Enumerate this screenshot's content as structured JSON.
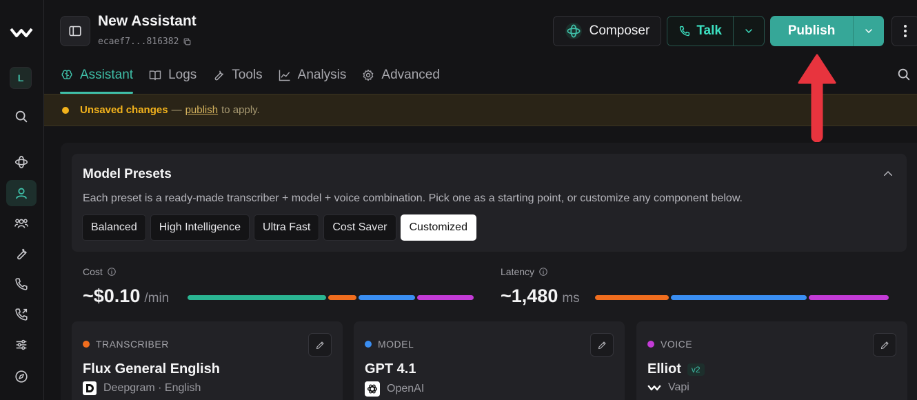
{
  "rail": {
    "workspace_initial": "L"
  },
  "header": {
    "title": "New Assistant",
    "assistant_id": "ecaef7...816382"
  },
  "actions": {
    "composer_label": "Composer",
    "talk_label": "Talk",
    "publish_label": "Publish"
  },
  "tabs": [
    {
      "label": "Assistant",
      "icon": "brain-icon",
      "active": true
    },
    {
      "label": "Logs",
      "icon": "book-icon",
      "active": false
    },
    {
      "label": "Tools",
      "icon": "wrench-icon",
      "active": false
    },
    {
      "label": "Analysis",
      "icon": "chart-line-icon",
      "active": false
    },
    {
      "label": "Advanced",
      "icon": "gear-icon",
      "active": false
    }
  ],
  "banner": {
    "status": "Unsaved changes",
    "dash": "—",
    "link": "publish",
    "suffix": "to apply."
  },
  "presets": {
    "title": "Model Presets",
    "description": "Each preset is a ready-made transcriber + model + voice combination. Pick one as a starting point, or customize any component below.",
    "options": [
      "Balanced",
      "High Intelligence",
      "Ultra Fast",
      "Cost Saver",
      "Customized"
    ],
    "selected": "Customized"
  },
  "cost": {
    "label": "Cost",
    "value": "~$0.10",
    "unit": "/min",
    "segments": [
      {
        "color": "#2ab592",
        "share": 0.49
      },
      {
        "color": "#f06d1e",
        "share": 0.1
      },
      {
        "color": "#3a8ef2",
        "share": 0.2
      },
      {
        "color": "#c33bd6",
        "share": 0.2
      }
    ]
  },
  "latency": {
    "label": "Latency",
    "value": "~1,480",
    "unit": "ms",
    "segments": [
      {
        "color": "#f06d1e",
        "share": 0.25
      },
      {
        "color": "#3a8ef2",
        "share": 0.46
      },
      {
        "color": "#c33bd6",
        "share": 0.27
      }
    ]
  },
  "components": {
    "transcriber": {
      "label": "TRANSCRIBER",
      "color": "#f06d1e",
      "name": "Flux General English",
      "provider": "Deepgram · English"
    },
    "model": {
      "label": "MODEL",
      "color": "#3a8ef2",
      "name": "GPT 4.1",
      "provider": "OpenAI"
    },
    "voice": {
      "label": "VOICE",
      "color": "#c33bd6",
      "name": "Elliot",
      "badge": "v2",
      "provider": "Vapi"
    }
  },
  "colors": {
    "accent": "#3fbfa8",
    "publish": "#36a798",
    "warning": "#f2b21c",
    "annotation_arrow": "#e8343e"
  }
}
